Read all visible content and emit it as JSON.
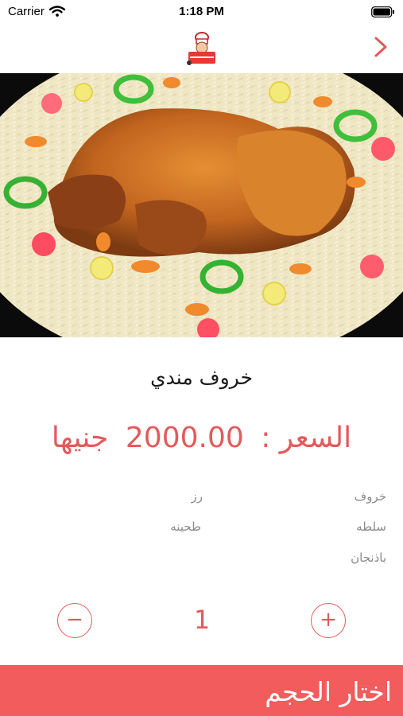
{
  "status_bar": {
    "carrier": "Carrier",
    "time": "1:18 PM"
  },
  "nav": {
    "logo_icon": "restaurant-chef-logo",
    "back_icon": "chevron-right-icon",
    "accent": "#e35a5b"
  },
  "product": {
    "image": "mandi-lamb-dish-photo",
    "name": "خروف مندي",
    "price_label": "السعر :",
    "price_value": "2000.00",
    "currency": "جنيها"
  },
  "ingredients": {
    "right": [
      "خروف",
      "سلطه",
      "باذنجان"
    ],
    "left": [
      "رز",
      "طحينه"
    ]
  },
  "quantity": {
    "minus": "−",
    "plus": "+",
    "value": "1"
  },
  "action": {
    "label": "اختار الحجم",
    "color": "#f25c5c"
  }
}
